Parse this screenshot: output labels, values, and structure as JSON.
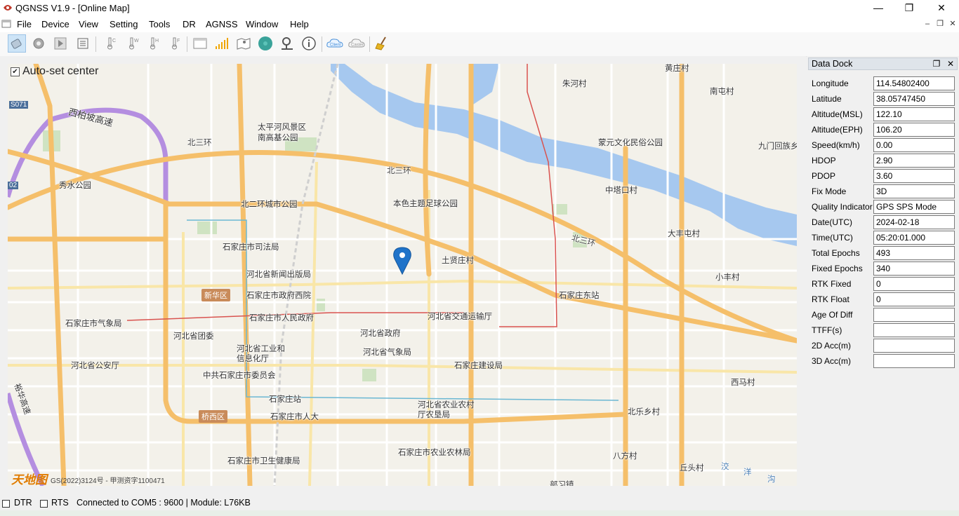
{
  "window": {
    "title": "QGNSS V1.9 - [Online Map]",
    "minimize": "—",
    "restore": "❐",
    "close": "✕"
  },
  "menu": {
    "items": [
      "File",
      "Device",
      "View",
      "Setting",
      "Tools",
      "DR",
      "AGNSS",
      "Window",
      "Help"
    ]
  },
  "toolbar": {
    "client_label": "Client",
    "caster_label": "Caster"
  },
  "map": {
    "auto_set_center_label": "Auto-set center",
    "auto_set_center_checked": true,
    "copyright": "GS(2022)3124号 - 甲测资字1100471",
    "logo_text": "天地图",
    "labels": [
      "黄庄村",
      "朱河村",
      "南屯村",
      "西柏坡高速",
      "S071",
      "太平河风景区",
      "南高基公园",
      "北三环",
      "北三环",
      "蒙元文化民俗公园",
      "九门回族乡",
      "秀水公园",
      "北二环城市公园",
      "本色主题足球公园",
      "中塔口村",
      "北三环",
      "大丰屯村",
      "石家庄市司法局",
      "土贤庄村",
      "河北省新闻出版局",
      "小丰村",
      "新华区",
      "石家庄市政府西院",
      "石家庄东站",
      "石家庄市气象局",
      "石家庄市人民政府",
      "河北省交通运输厅",
      "河北省团委",
      "河北省政府",
      "河北省工业和",
      "信息化厅",
      "河北省气象局",
      "河北省公安厅",
      "石家庄建设局",
      "中共石家庄市委员会",
      "西马村",
      "石家庄站",
      "河北省农业农村",
      "厅农垦局",
      "桥西区",
      "石家庄市人大",
      "北乐乡村",
      "石家庄市农业农林局",
      "八方村",
      "石家庄市卫生健康局",
      "丘头村",
      "洨",
      "洋",
      "沟",
      "部习镇",
      "裕华高速",
      "02"
    ]
  },
  "dock": {
    "title": "Data Dock",
    "rows": [
      {
        "label": "Longitude",
        "value": "114.54802400"
      },
      {
        "label": "Latitude",
        "value": "38.05747450"
      },
      {
        "label": "Altitude(MSL)",
        "value": "122.10"
      },
      {
        "label": "Altitude(EPH)",
        "value": "106.20"
      },
      {
        "label": "Speed(km/h)",
        "value": "0.00"
      },
      {
        "label": "HDOP",
        "value": "2.90"
      },
      {
        "label": "PDOP",
        "value": "3.60"
      },
      {
        "label": "Fix Mode",
        "value": "3D"
      },
      {
        "label": "Quality Indicator",
        "value": "GPS SPS Mode"
      },
      {
        "label": "Date(UTC)",
        "value": "2024-02-18"
      },
      {
        "label": "Time(UTC)",
        "value": "05:20:01.000"
      },
      {
        "label": "Total Epochs",
        "value": "493"
      },
      {
        "label": "Fixed Epochs",
        "value": "340"
      },
      {
        "label": "RTK Fixed",
        "value": "0"
      },
      {
        "label": "RTK Float",
        "value": "0"
      },
      {
        "label": "Age Of Diff",
        "value": ""
      },
      {
        "label": "TTFF(s)",
        "value": ""
      },
      {
        "label": "2D Acc(m)",
        "value": ""
      },
      {
        "label": "3D Acc(m)",
        "value": ""
      }
    ]
  },
  "status": {
    "dtr_label": "DTR",
    "rts_label": "RTS",
    "connection": "Connected to COM5 : 9600 | Module: L76KB"
  },
  "colors": {
    "road_major": "#f5bf6a",
    "river": "#a6c8ef",
    "park": "#cfe3c2",
    "expressway": "#b48ee0"
  }
}
